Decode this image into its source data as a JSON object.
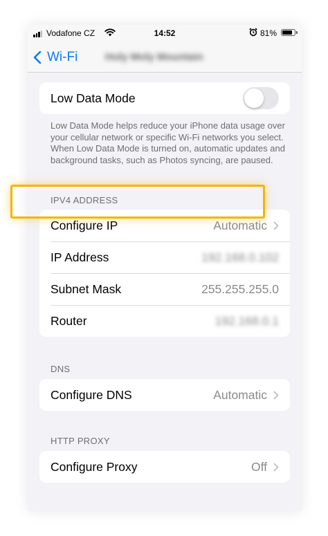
{
  "status_bar": {
    "carrier": "Vodafone CZ",
    "time": "14:52",
    "battery_percent": "81%",
    "battery_level": 0.81,
    "icons": [
      "signal-icon",
      "wifi-icon",
      "alarm-icon",
      "battery-icon"
    ]
  },
  "nav": {
    "back_label": "Wi-Fi",
    "network_name": "Holy Moly Mountain"
  },
  "low_data": {
    "label": "Low Data Mode",
    "enabled": false,
    "footnote": "Low Data Mode helps reduce your iPhone data usage over your cellular network or specific Wi-Fi networks you select. When Low Data Mode is turned on, automatic updates and background tasks, such as Photos syncing, are paused."
  },
  "ipv4": {
    "header": "IPV4 ADDRESS",
    "configure_ip": {
      "label": "Configure IP",
      "value": "Automatic"
    },
    "ip_address": {
      "label": "IP Address",
      "value": "192.168.0.102"
    },
    "subnet_mask": {
      "label": "Subnet Mask",
      "value": "255.255.255.0"
    },
    "router": {
      "label": "Router",
      "value": "192.168.0.1"
    }
  },
  "dns": {
    "header": "DNS",
    "configure_dns": {
      "label": "Configure DNS",
      "value": "Automatic"
    }
  },
  "proxy": {
    "header": "HTTP PROXY",
    "configure_proxy": {
      "label": "Configure Proxy",
      "value": "Off"
    }
  },
  "colors": {
    "accent": "#0a7aff",
    "highlight": "#f5b400",
    "background": "#f2f2f7"
  }
}
